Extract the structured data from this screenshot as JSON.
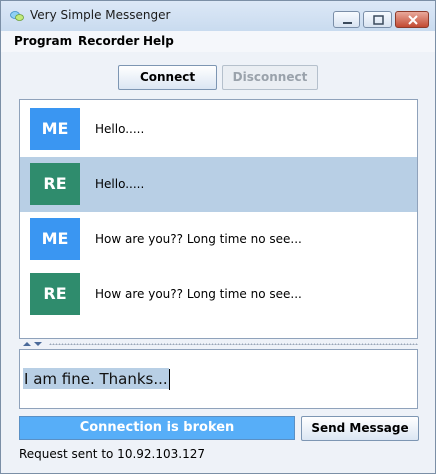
{
  "window": {
    "title": "Very Simple Messenger"
  },
  "menu": {
    "items": [
      "Program",
      "Recorder",
      "Help"
    ]
  },
  "toolbar": {
    "connect_label": "Connect",
    "disconnect_label": "Disconnect"
  },
  "messages": [
    {
      "avatar": "ME",
      "text": "Hello.....",
      "color": "#3a96f2",
      "selected": false
    },
    {
      "avatar": "RE",
      "text": "Hello.....",
      "color": "#2f8c6d",
      "selected": true
    },
    {
      "avatar": "ME",
      "text": "How are you?? Long time no see...",
      "color": "#3a96f2",
      "selected": false
    },
    {
      "avatar": "RE",
      "text": "How are you?? Long time no see...",
      "color": "#2f8c6d",
      "selected": false
    }
  ],
  "input": {
    "value": "I am fine. Thanks..."
  },
  "status": {
    "text": "Connection is broken",
    "color": "#57aef8"
  },
  "send_label": "Send Message",
  "footer": {
    "request_info": "Request sent to 10.92.103.127"
  }
}
